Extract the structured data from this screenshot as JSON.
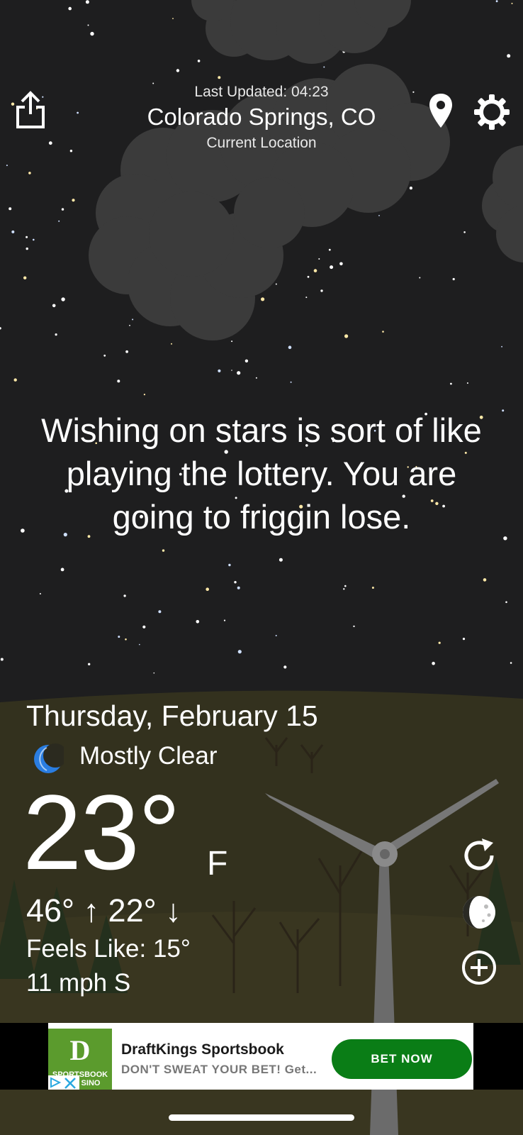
{
  "header": {
    "last_updated": "Last Updated: 04:23",
    "city": "Colorado Springs, CO",
    "location_label": "Current Location"
  },
  "icons": {
    "share": "share-icon",
    "location": "map-pin-icon",
    "settings": "gear-icon",
    "refresh": "refresh-icon",
    "moon_phase": "moon-phase-icon",
    "add": "add-circle-icon",
    "condition": "crescent-moon-icon"
  },
  "quote": "Wishing on stars is sort of like playing the lottery. You are going to friggin lose.",
  "weather": {
    "date": "Thursday, February 15",
    "condition": "Mostly Clear",
    "temperature": "23°",
    "unit": "F",
    "hi_lo": "46° ↑  22° ↓",
    "feels_like": "Feels Like: 15°",
    "wind": "11 mph S"
  },
  "ad": {
    "logo_text": "SPORTSBOOK CASINO",
    "title": "DraftKings Sportsbook",
    "description": "DON'T SWEAT YOUR BET! Get...",
    "cta": "BET NOW"
  },
  "colors": {
    "sky": "#1e1e1f",
    "ground": "#34321f",
    "cta": "#0a7d16",
    "moon_icon": "#2a7de1"
  }
}
